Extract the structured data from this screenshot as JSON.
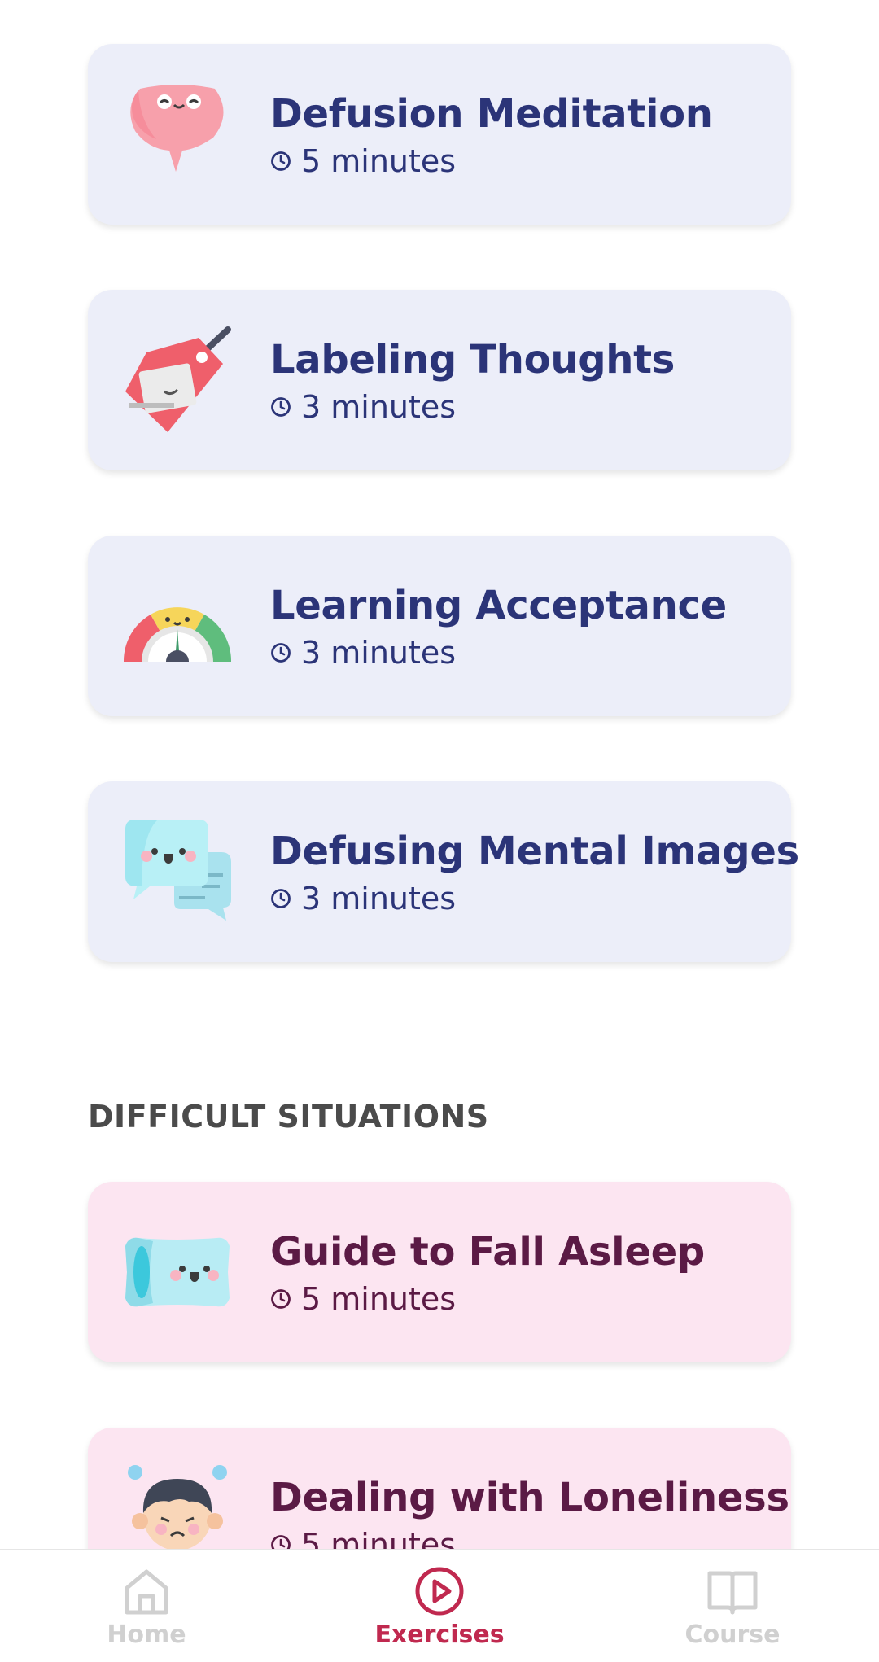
{
  "exercises": [
    {
      "title": "Defusion Meditation",
      "duration": "5 minutes",
      "icon": "brain-icon"
    },
    {
      "title": "Labeling Thoughts",
      "duration": "3 minutes",
      "icon": "tag-icon"
    },
    {
      "title": "Learning Acceptance",
      "duration": "3 minutes",
      "icon": "gauge-icon"
    },
    {
      "title": "Defusing Mental Images",
      "duration": "3 minutes",
      "icon": "chat-bubbles-icon"
    }
  ],
  "difficult_situations": {
    "section_title": "DIFFICULT SITUATIONS",
    "items": [
      {
        "title": "Guide to Fall Asleep",
        "duration": "5 minutes",
        "icon": "pillow-icon"
      },
      {
        "title": "Dealing with Loneliness",
        "duration": "5 minutes",
        "icon": "sad-boy-icon"
      }
    ]
  },
  "bottom_nav": {
    "items": [
      {
        "label": "Home",
        "icon": "home-icon",
        "active": false
      },
      {
        "label": "Exercises",
        "icon": "play-circle-icon",
        "active": true
      },
      {
        "label": "Course",
        "icon": "book-icon",
        "active": false
      }
    ]
  },
  "colors": {
    "card_blue": "#eceef9",
    "card_pink": "#fce5f1",
    "title_blue": "#2b3478",
    "title_pink": "#5b1a45",
    "accent": "#c0294f"
  }
}
